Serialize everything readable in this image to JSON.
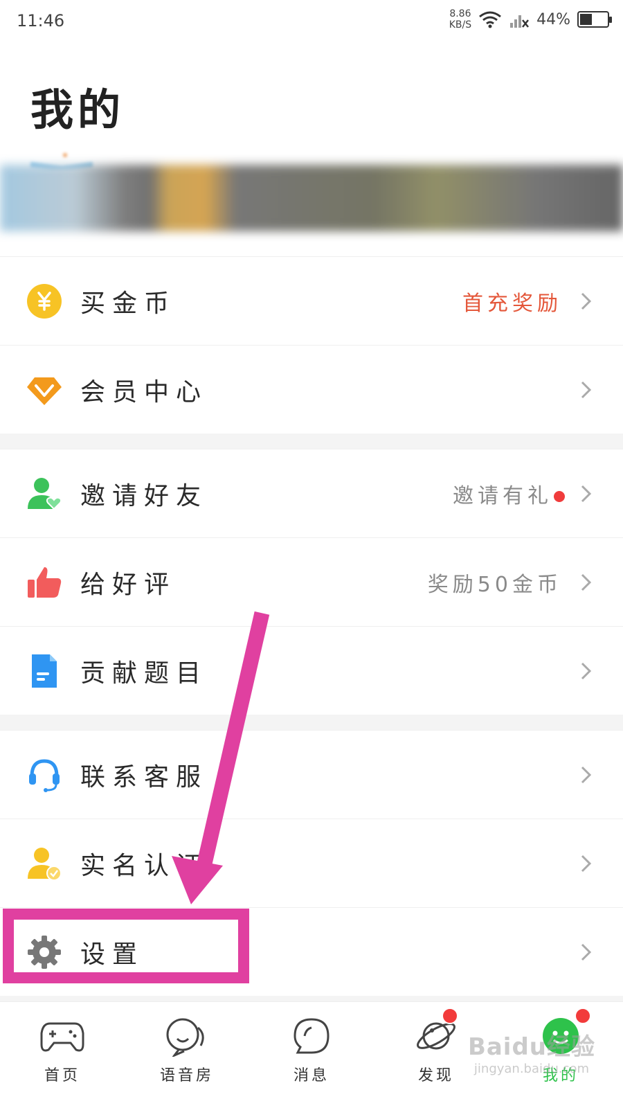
{
  "status_bar": {
    "time": "11:46",
    "net_speed_value": "8.86",
    "net_speed_unit": "KB/S",
    "battery_text": "44%",
    "battery_level": 0.44
  },
  "page": {
    "title": "我的"
  },
  "menu": [
    {
      "label": "买金币",
      "right_text": "首充奖励",
      "right_color": "#e4573a",
      "icon": "yuan-coin-icon",
      "icon_color": "#f7c325",
      "dot": false
    },
    {
      "label": "会员中心",
      "right_text": "",
      "icon": "diamond-icon",
      "icon_color": "#f39a1c",
      "dot": false
    },
    {
      "label": "邀请好友",
      "right_text": "邀请有礼",
      "right_color": "#8a8a8a",
      "icon": "user-heart-icon",
      "icon_color": "#3cc25a",
      "dot": true
    },
    {
      "label": "给好评",
      "right_text": "奖励50金币",
      "right_color": "#8a8a8a",
      "icon": "thumbs-up-icon",
      "icon_color": "#f25c5c",
      "dot": false
    },
    {
      "label": "贡献题目",
      "right_text": "",
      "icon": "document-icon",
      "icon_color": "#2f95f2",
      "dot": false
    },
    {
      "label": "联系客服",
      "right_text": "",
      "icon": "headset-icon",
      "icon_color": "#2f95f2",
      "dot": false
    },
    {
      "label": "实名认证",
      "right_text": "",
      "icon": "user-verified-icon",
      "icon_color": "#f7c325",
      "dot": false
    },
    {
      "label": "设置",
      "right_text": "",
      "icon": "gear-icon",
      "icon_color": "#777777",
      "dot": false
    }
  ],
  "tabs": [
    {
      "label": "首页",
      "icon": "gamepad-icon",
      "active": false,
      "badge": false
    },
    {
      "label": "语音房",
      "icon": "voice-room-icon",
      "active": false,
      "badge": false
    },
    {
      "label": "消息",
      "icon": "chat-bubble-icon",
      "active": false,
      "badge": false
    },
    {
      "label": "发现",
      "icon": "planet-icon",
      "active": false,
      "badge": true
    },
    {
      "label": "我的",
      "icon": "smile-face-icon",
      "active": true,
      "badge": true
    }
  ],
  "watermark": {
    "main": "Baidu经验",
    "sub": "jingyan.baidu.com"
  },
  "colors": {
    "accent_green": "#2ec24b",
    "badge_red": "#f23b3b",
    "annotation_pink": "#e040a0"
  }
}
